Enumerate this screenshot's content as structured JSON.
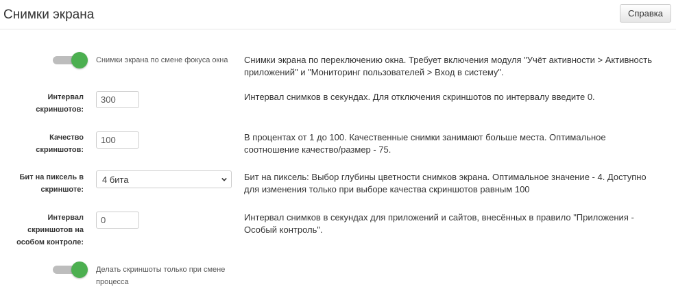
{
  "header": {
    "title": "Снимки экрана",
    "help_label": "Справка"
  },
  "focus_toggle": {
    "label": "Снимки экрана по смене фокуса окна",
    "enabled": true,
    "description": "Снимки экрана по переключению окна. Требует включения модуля \"Учёт активности > Активность приложений\" и \"Мониторинг пользователей > Вход в систему\"."
  },
  "interval": {
    "label_line1": "Интервал",
    "label_line2": "скриншотов:",
    "value": "300",
    "description": "Интервал снимков в секундах. Для отключения скриншотов по интервалу введите 0."
  },
  "quality": {
    "label_line1": "Качество",
    "label_line2": "скриншотов:",
    "value": "100",
    "description": "В процентах от 1 до 100. Качественные снимки занимают больше места. Оптимальное соотношение качество/размер - 75."
  },
  "bits": {
    "label_line1": "Бит на пиксель в",
    "label_line2": "скриншоте:",
    "selected": "4 бита",
    "description": "Бит на пиксель: Выбор глубины цветности снимков экрана. Оптимальное значение - 4. Доступно для изменения только при выборе качества скриншотов равным 100"
  },
  "special_interval": {
    "label_line1": "Интервал",
    "label_line2": "скриншотов на",
    "label_line3": "особом контроле:",
    "value": "0",
    "description": "Интервал снимков в секундах для приложений и сайтов, внесённых в правило \"Приложения - Особый контроль\"."
  },
  "process_toggle": {
    "label_line1": "Делать скриншоты только при смене",
    "label_line2": "процесса",
    "enabled": true
  },
  "colors": {
    "toggle_on": "#4caf50",
    "toggle_track": "#bdbdbd"
  }
}
